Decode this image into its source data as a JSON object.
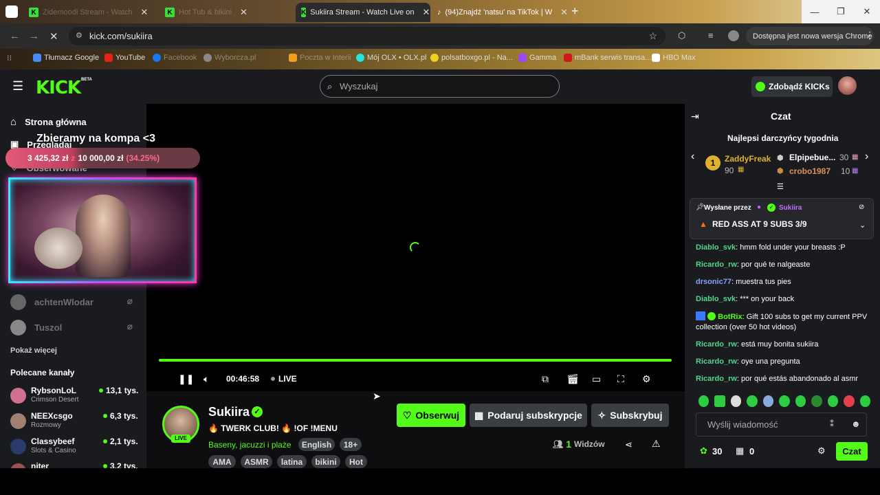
{
  "browser": {
    "tabs": [
      {
        "title": "Zidemoodi Stream - Watch",
        "icon": "kick-icon"
      },
      {
        "title": "Hot Tub & bikini",
        "icon": "kick-icon"
      },
      {
        "title": "Sukiira Stream - Watch Live on",
        "icon": "kick-icon"
      },
      {
        "title": "(94)Znajdź 'natsu' na TikTok | W",
        "icon": "tiktok-icon"
      }
    ],
    "new_tab": "+",
    "url": "kick.com/sukiira",
    "update_notice": "Dostępna jest nowa wersja Chrome",
    "bookmarks": [
      "Tłumacz Google",
      "YouTube",
      "Facebook",
      "Wyborcza.pl",
      "Poczta w Interii",
      "Mój OLX • OLX.pl",
      "polsatboxgo.pl - Na...",
      "Gamma",
      "mBank serwis transa...",
      "HBO Max"
    ]
  },
  "site": {
    "logo": "KICK",
    "beta": "BETA",
    "search_placeholder": "Wyszukaj",
    "get_kicks": "Zdobądź KICKs"
  },
  "sidebar": {
    "home": "Strona główna",
    "browse": "Przeglądaj",
    "following": "Obserwowane",
    "followed_channels": [
      {
        "name": "achtenWlodar"
      },
      {
        "name": "Tuszol"
      }
    ],
    "show_more": "Pokaż więcej",
    "recommended_title": "Polecane kanały",
    "recommended": [
      {
        "name": "RybsonLoL",
        "category": "Crimson Desert",
        "viewers": "13,1 tys."
      },
      {
        "name": "NEEXcsgo",
        "category": "Rozmowy",
        "viewers": "6,3 tys."
      },
      {
        "name": "Classybeef",
        "category": "Slots & Casino",
        "viewers": "2,1 tys."
      },
      {
        "name": "niter",
        "category": "",
        "viewers": "3,2 tys."
      }
    ]
  },
  "overlay": {
    "title": "Zbieramy na kompa <3",
    "goal_current": "3 425,32 zł",
    "goal_sep": "z",
    "goal_target": "10 000,00 zł",
    "goal_percent": "(34.25%)",
    "goal_fraction": 0.3425
  },
  "player": {
    "time": "00:46:58",
    "live": "LIVE",
    "progress_fraction": 1.0
  },
  "channel": {
    "name": "Sukiira",
    "live_badge": "LIVE",
    "stream_title": "🔥 TWERK CLUB! 🔥 !OF !MENU",
    "category": "Baseny, jacuzzi i plaże",
    "tags": [
      "English",
      "18+",
      "AMA",
      "ASMR",
      "latina",
      "bikini",
      "Hot"
    ],
    "follow": "Obserwuj",
    "gift_subs": "Podaruj subskrypcje",
    "subscribe": "Subskrybuj",
    "viewers_count": "1",
    "viewers_label": "Widzów"
  },
  "chat": {
    "title": "Czat",
    "gifters_title": "Najlepsi darczyńcy tygodnia",
    "gifters": [
      {
        "rank": "1",
        "name": "ZaddyFreak",
        "count": "90"
      },
      {
        "name": "Elpipebue...",
        "count": "30"
      },
      {
        "name": "crobo1987",
        "count": "10"
      }
    ],
    "pinned_by": "Wysłane przez",
    "pinned_author": "Sukiira",
    "pinned_text": "RED ASS AT 9 SUBS 3/9",
    "messages": [
      {
        "user": "Diablo_svk",
        "color": "#53d68a",
        "text": "hmm fold under your breasts :P"
      },
      {
        "user": "Ricardo_rw",
        "color": "#53d68a",
        "text": "por qué te nalgeaste"
      },
      {
        "user": "drsonic77",
        "color": "#8a9fff",
        "text": "muestra tus pies"
      },
      {
        "user": "Diablo_svk",
        "color": "#53d68a",
        "text": "*** on your back"
      },
      {
        "user": "BotRix",
        "color": "#53fc18",
        "text": "Gift 100 subs to get my current PPV collection (over 50 hot videos)"
      },
      {
        "user": "Ricardo_rw",
        "color": "#53d68a",
        "text": "está muy bonita sukiira"
      },
      {
        "user": "Ricardo_rw",
        "color": "#53d68a",
        "text": "oye una pregunta"
      },
      {
        "user": "Ricardo_rw",
        "color": "#53d68a",
        "text": "por qué estás abandonado al asmr"
      }
    ],
    "input_placeholder": "Wyślij wiadomość",
    "kicks_count": "30",
    "gift_count": "0",
    "send": "Czat"
  }
}
